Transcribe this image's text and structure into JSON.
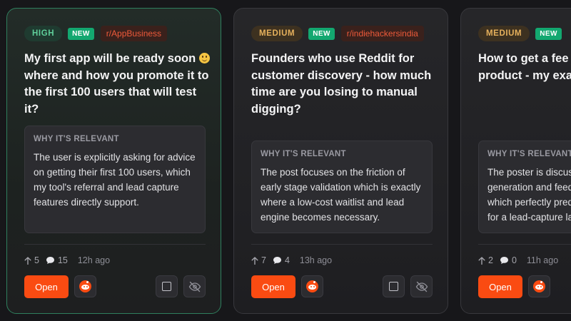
{
  "cards": [
    {
      "priority": "HIGH",
      "new_badge": "NEW",
      "subreddit": "r/AppBusiness",
      "title_before_emoji": "My first app will be ready soon ",
      "emoji": "slightly-smiling-face",
      "title_after_emoji": " where and how you promote it to the first 100 users that will test it?",
      "why_heading": "WHY IT'S RELEVANT",
      "why_text": "The user is explicitly asking for advice on getting their first 100 users, which my tool's referral and lead capture features directly support.",
      "upvotes": "5",
      "comments": "15",
      "age": "12h ago",
      "open_label": "Open"
    },
    {
      "priority": "MEDIUM",
      "new_badge": "NEW",
      "subreddit": "r/indiehackersindia",
      "title": "Founders who use Reddit for customer discovery - how much time are you losing to manual digging?",
      "why_heading": "WHY IT'S RELEVANT",
      "why_text": "The post focuses on the friction of early stage validation which is exactly where a low-cost waitlist and lead engine becomes necessary.",
      "upvotes": "7",
      "comments": "4",
      "age": "13h ago",
      "open_label": "Open"
    },
    {
      "priority": "MEDIUM",
      "new_badge": "NEW",
      "title_line1": "How to get a fee",
      "title_line2": "product - my exa",
      "why_heading": "WHY IT'S RELEVANT",
      "why_line1": "The poster is discus",
      "why_line2": "generation and feed",
      "why_line3": "which perfectly pred",
      "why_line4": "for a lead-capture la",
      "upvotes": "2",
      "comments": "0",
      "age": "11h ago",
      "open_label": "Open"
    }
  ],
  "colors": {
    "accent_open": "#fa4b12",
    "high_border": "#2f7f5e",
    "new_badge": "#13a870"
  }
}
